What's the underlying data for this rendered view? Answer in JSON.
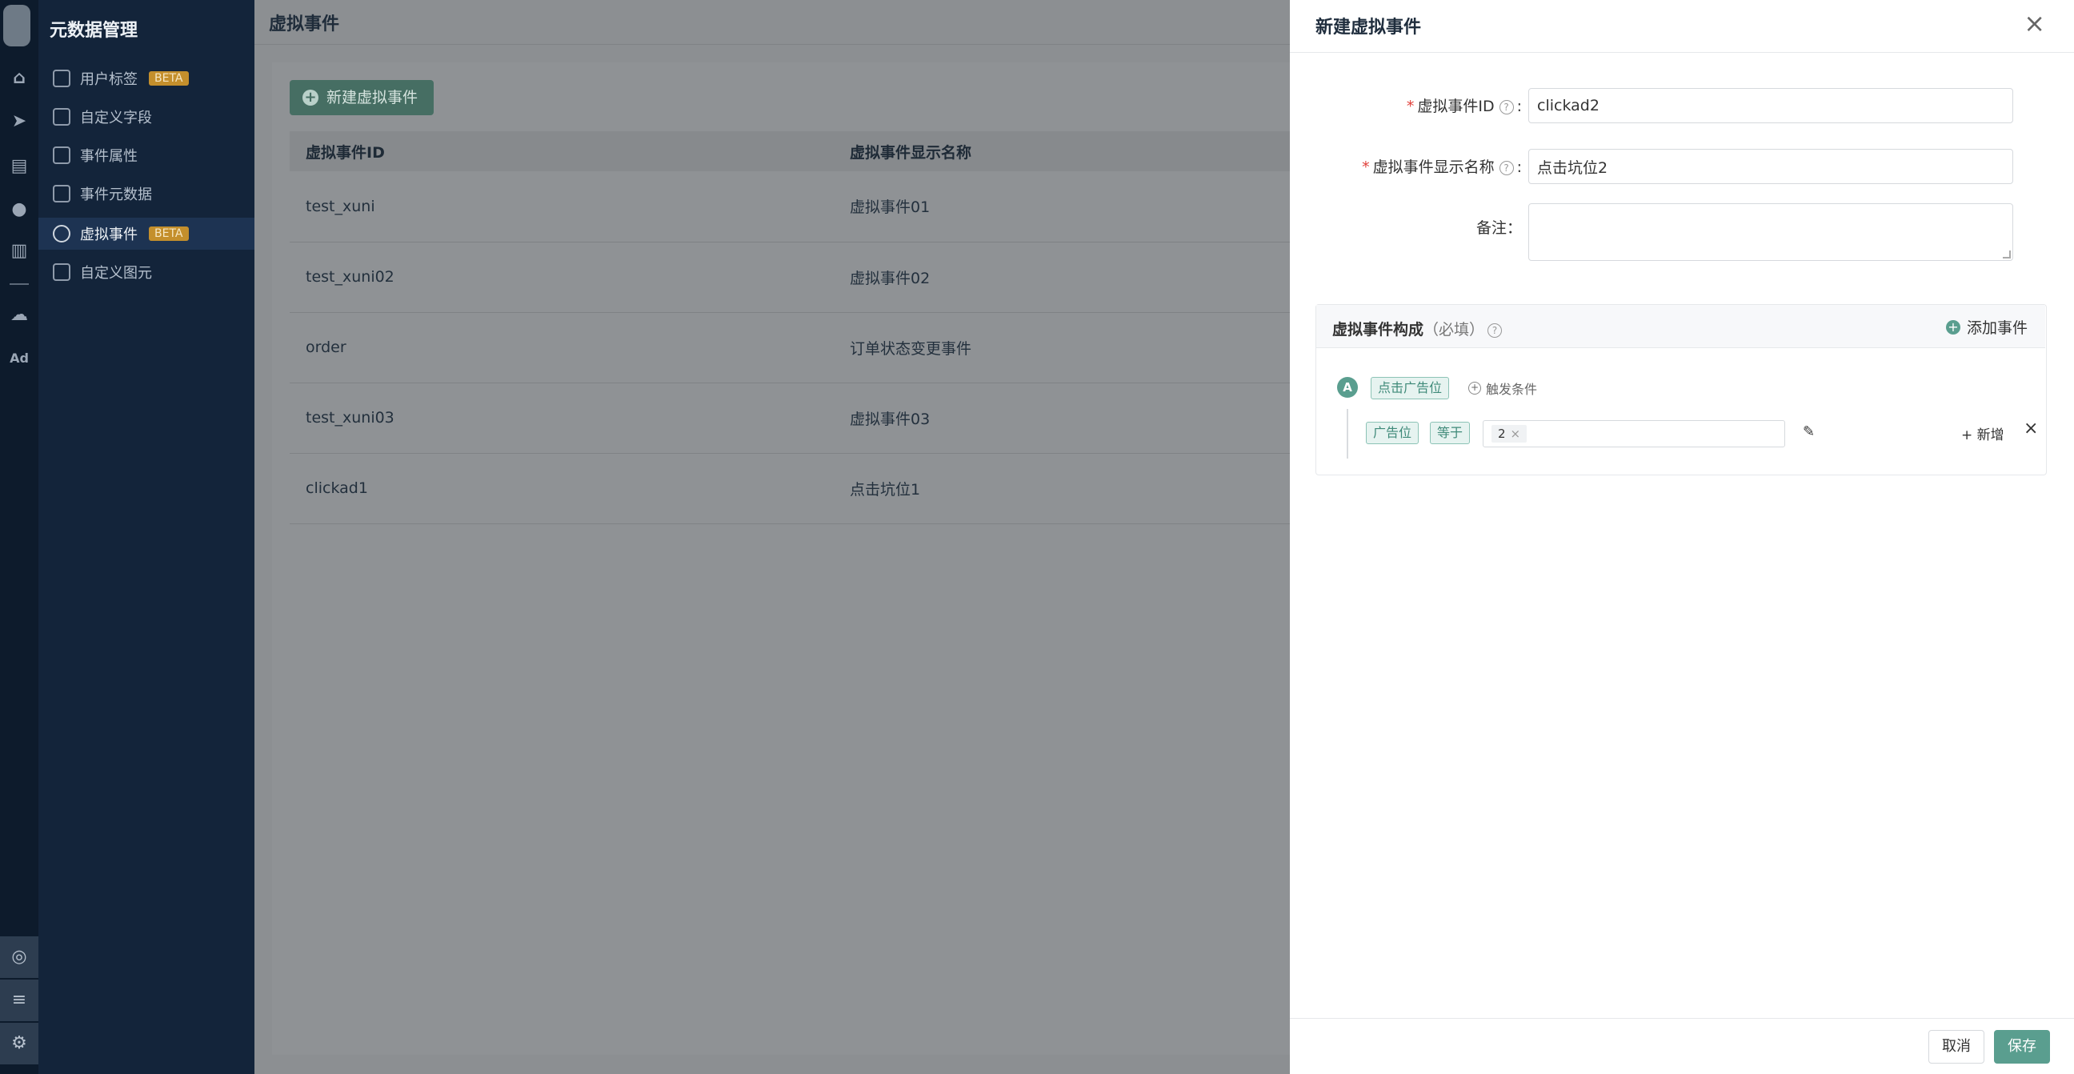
{
  "sidebar": {
    "title": "元数据管理",
    "items": [
      {
        "label": "用户标签",
        "badge": "BETA"
      },
      {
        "label": "自定义字段"
      },
      {
        "label": "事件属性"
      },
      {
        "label": "事件元数据"
      },
      {
        "label": "虚拟事件",
        "badge": "BETA",
        "active": true
      },
      {
        "label": "自定义图元"
      }
    ]
  },
  "rail": {
    "icons": [
      "home-icon",
      "send-icon",
      "layout-icon",
      "user-icon",
      "bar-chart-icon",
      "wechat-icon",
      "ad-icon"
    ],
    "ad_label": "Ad",
    "bottom_icons": [
      "target-icon",
      "list-icon",
      "gear-icon"
    ]
  },
  "main": {
    "title": "虚拟事件",
    "new_button": "新建虚拟事件",
    "table": {
      "columns": [
        "虚拟事件ID",
        "虚拟事件显示名称"
      ],
      "rows": [
        [
          "test_xuni",
          "虚拟事件01"
        ],
        [
          "test_xuni02",
          "虚拟事件02"
        ],
        [
          "order",
          "订单状态变更事件"
        ],
        [
          "test_xuni03",
          "虚拟事件03"
        ],
        [
          "clickad1",
          "点击坑位1"
        ]
      ]
    }
  },
  "drawer": {
    "title": "新建虚拟事件",
    "fields": {
      "event_id": {
        "label": "虚拟事件ID",
        "suffix": ":",
        "value": "clickad2"
      },
      "display_name": {
        "label": "虚拟事件显示名称",
        "suffix": ":",
        "value": "点击坑位2"
      },
      "remark": {
        "label": "备注：",
        "value": ""
      }
    },
    "composition": {
      "title": "虚拟事件构成",
      "note": "（必填）",
      "add_event": "添加事件",
      "event_letter": "A",
      "event_tag": "点击广告位",
      "trigger": "触发条件",
      "condition": {
        "property": "广告位",
        "operator": "等于",
        "value": "2"
      },
      "add_condition": "+ 新增"
    },
    "footer": {
      "cancel": "取消",
      "save": "保存"
    }
  },
  "colors": {
    "accent": "#5a9e8f",
    "sidebar_bg": "#13243a",
    "rail_bg": "#0d1b2c",
    "beta": "#c48f2c"
  }
}
